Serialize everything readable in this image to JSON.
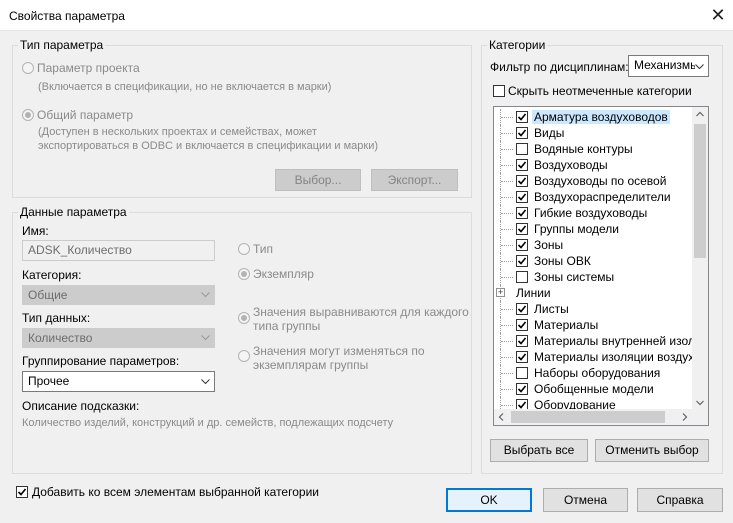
{
  "window": {
    "title": "Свойства параметра",
    "close_glyph": "✕"
  },
  "param_type": {
    "title": "Тип параметра",
    "project_label": "Параметр проекта",
    "project_desc": "(Включается в спецификации, но не включается в марки)",
    "shared_label": "Общий параметр",
    "shared_desc_1": "(Доступен в нескольких проектах и семействах, может",
    "shared_desc_2": "экспортироваться в ODBC и включается в спецификации и марки)",
    "select_button": "Выбор...",
    "export_button": "Экспорт..."
  },
  "param_data": {
    "title": "Данные параметра",
    "name_label": "Имя:",
    "name_value": "ADSK_Количество",
    "category_label": "Категория:",
    "category_value": "Общие",
    "data_type_label": "Тип данных:",
    "data_type_value": "Количество",
    "group_label": "Группирование параметров:",
    "group_value": "Прочее",
    "tooltip_label": "Описание подсказки:",
    "tooltip_text": "Количество изделий, конструкций и др. семейств, подлежащих подсчету",
    "type_radio": "Тип",
    "instance_radio": "Экземпляр",
    "align_radio_1": "Значения выравниваются для каждого",
    "align_radio_2": "типа группы",
    "vary_radio_1": "Значения могут изменяться по",
    "vary_radio_2": "экземплярам группы"
  },
  "categories": {
    "title": "Категории",
    "filter_label": "Фильтр по дисциплинам:",
    "filter_value": "Механизмы",
    "hide_unchecked_label": "Скрыть неотмеченные категории",
    "items": [
      {
        "label": "Арматура воздуховодов",
        "checked": true,
        "selected": true
      },
      {
        "label": "Виды",
        "checked": true
      },
      {
        "label": "Водяные контуры",
        "checked": false
      },
      {
        "label": "Воздуховоды",
        "checked": true
      },
      {
        "label": "Воздуховоды по осевой",
        "checked": true
      },
      {
        "label": "Воздухораспределители",
        "checked": true
      },
      {
        "label": "Гибкие воздуховоды",
        "checked": true
      },
      {
        "label": "Группы модели",
        "checked": true
      },
      {
        "label": "Зоны",
        "checked": true
      },
      {
        "label": "Зоны ОВК",
        "checked": true
      },
      {
        "label": "Зоны системы",
        "checked": false
      },
      {
        "label": "Линии",
        "checked": null,
        "expander": "+"
      },
      {
        "label": "Листы",
        "checked": true
      },
      {
        "label": "Материалы",
        "checked": true
      },
      {
        "label": "Материалы внутренней изоляции",
        "checked": true
      },
      {
        "label": "Материалы изоляции воздуховодов",
        "checked": true
      },
      {
        "label": "Наборы оборудования",
        "checked": false
      },
      {
        "label": "Обобщенные модели",
        "checked": true
      },
      {
        "label": "Оборудование",
        "checked": true
      }
    ],
    "select_all_button": "Выбрать все",
    "deselect_button": "Отменить выбор"
  },
  "footer": {
    "add_all_label": "Добавить ко всем элементам выбранной категории",
    "add_all_checked": true,
    "ok_button": "OK",
    "cancel_button": "Отмена",
    "help_button": "Справка"
  }
}
